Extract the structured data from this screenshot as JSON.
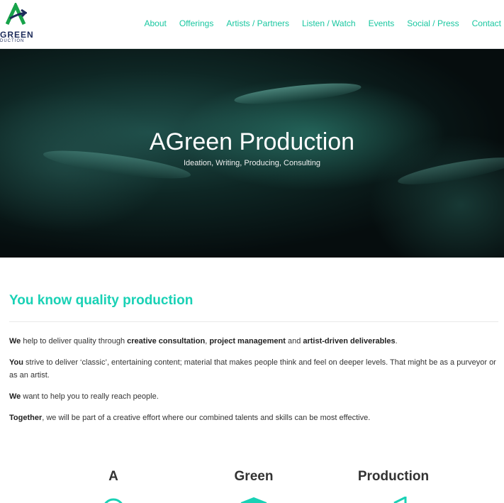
{
  "brand": {
    "logo_letter": "A",
    "logo_word": "GREEN",
    "logo_sub": "DUCTION",
    "accent_color": "#19c7a0",
    "logo_green": "#17a34a",
    "logo_navy": "#1c2b5a"
  },
  "nav": {
    "items": [
      {
        "label": "About"
      },
      {
        "label": "Offerings"
      },
      {
        "label": "Artists / Partners"
      },
      {
        "label": "Listen / Watch"
      },
      {
        "label": "Events"
      },
      {
        "label": "Social / Press"
      },
      {
        "label": "Contact"
      }
    ]
  },
  "hero": {
    "title": "AGreen Production",
    "subtitle": "Ideation, Writing, Producing, Consulting"
  },
  "intro": {
    "heading": "You know quality production",
    "p1": {
      "lead": "We",
      "t1": " help to deliver quality through ",
      "b1": "creative consultation",
      "t2": ", ",
      "b2": "project management",
      "t3": " and ",
      "b3": "artist-driven deliverables",
      "t4": "."
    },
    "p2": {
      "lead": "You",
      "text": " strive to deliver ‘classic’, entertaining content; material that makes people think and feel on deeper levels. That might be as a purveyor or as an artist."
    },
    "p3": {
      "lead": "We",
      "text": " want to help you to really reach people."
    },
    "p4": {
      "lead": "Together",
      "text": ", we will be part of a creative effort where our combined talents and skills can be most effective."
    }
  },
  "columns": [
    {
      "title": "A",
      "icon": "circle-icon"
    },
    {
      "title": "Green",
      "icon": "graduation-cap-icon"
    },
    {
      "title": "Production",
      "icon": "megaphone-icon"
    }
  ]
}
